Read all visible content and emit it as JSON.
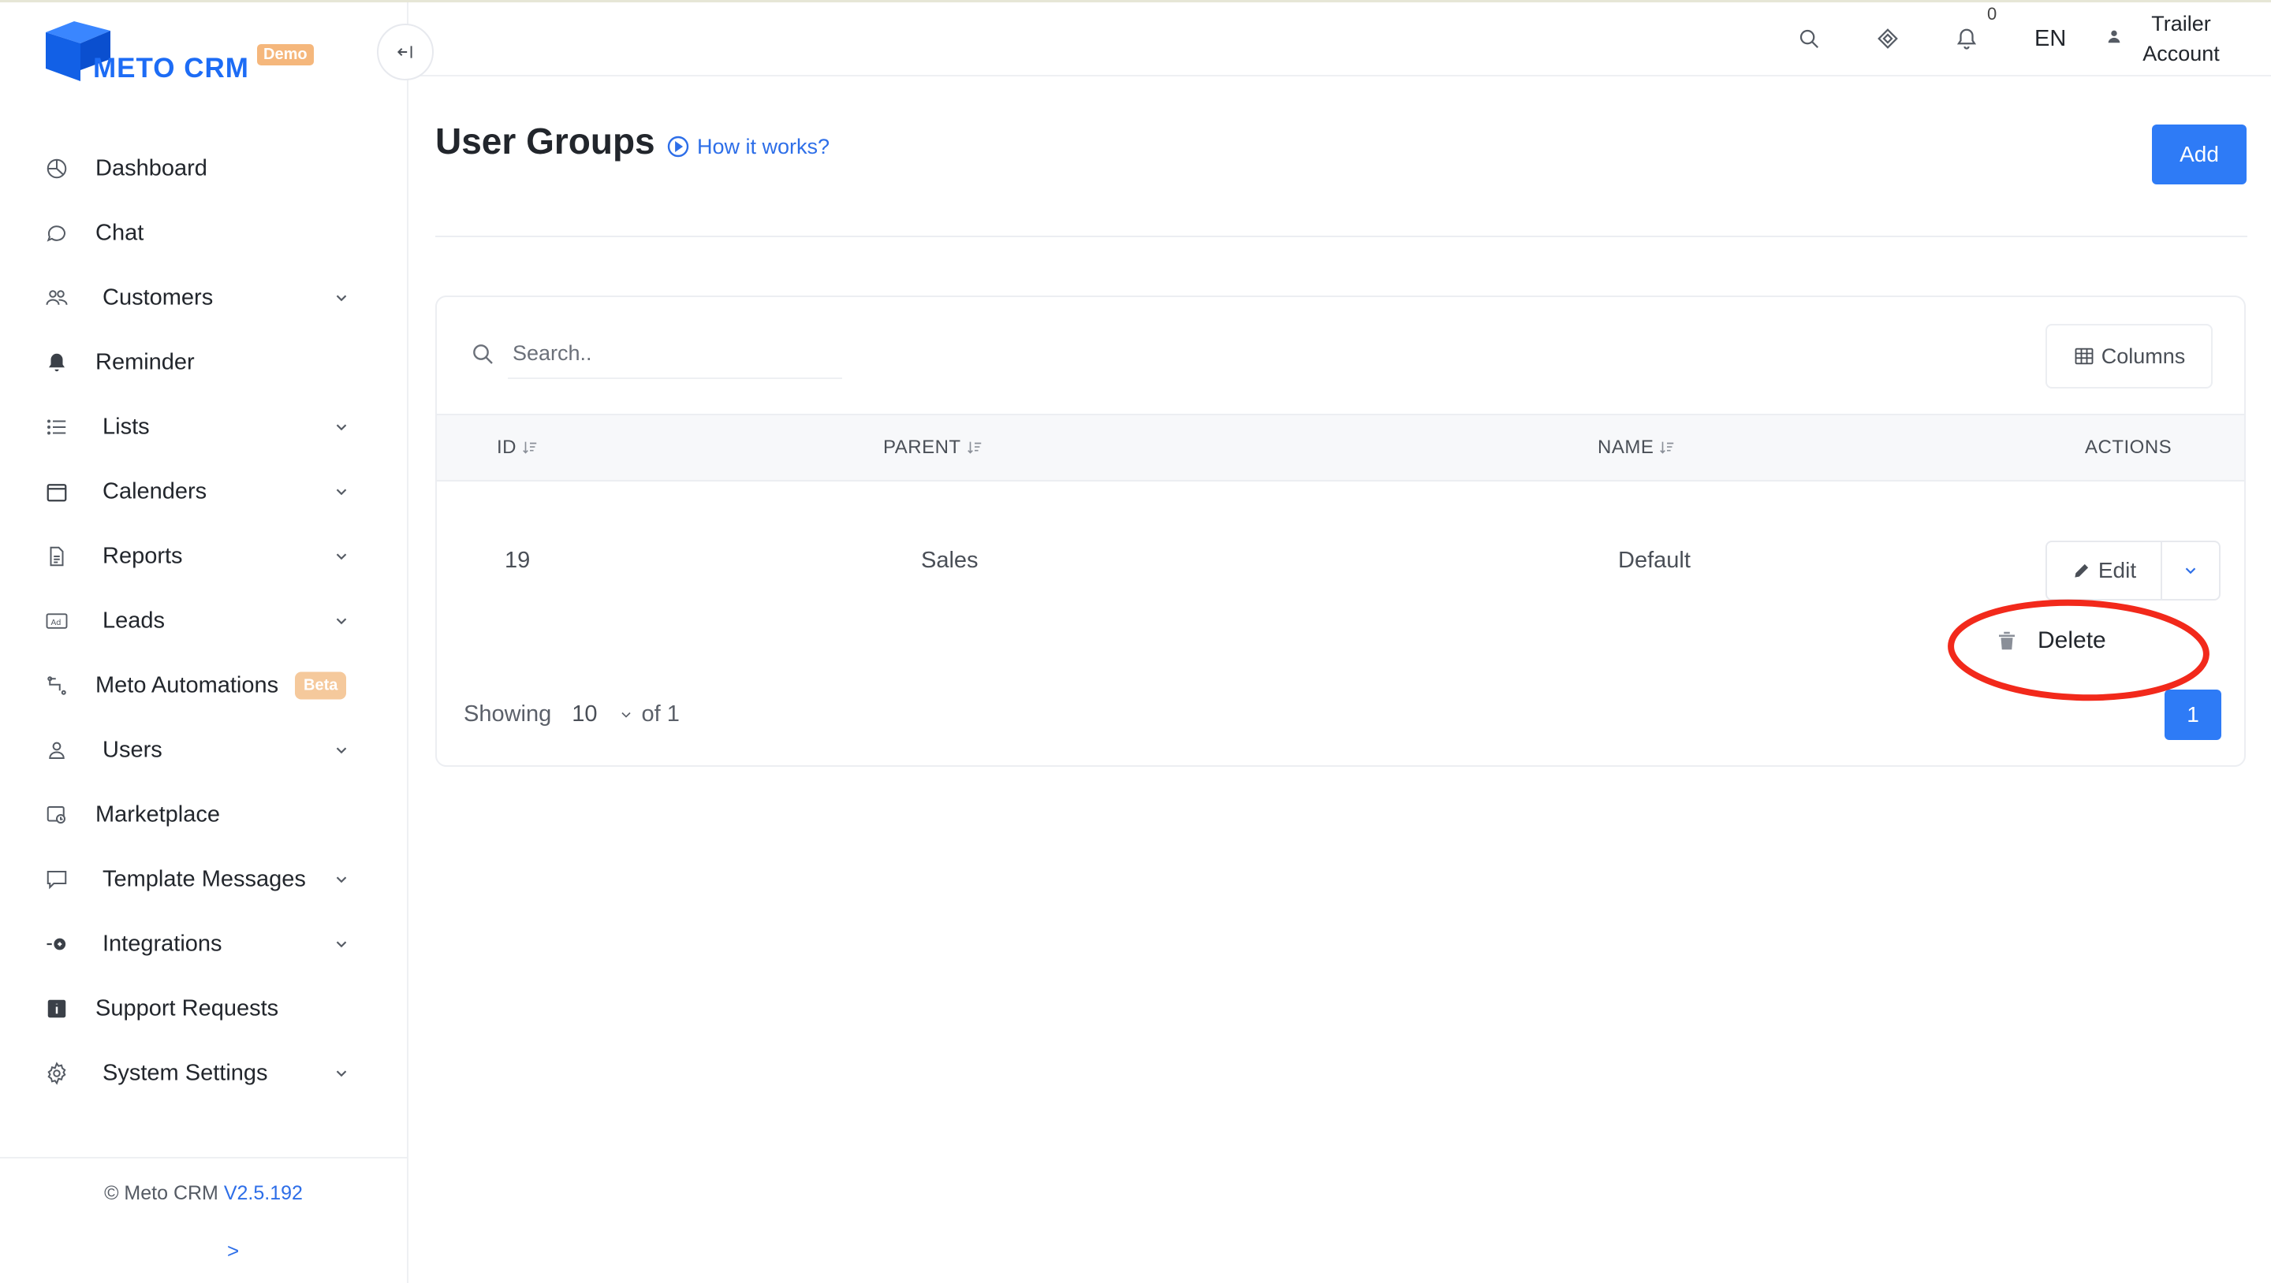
{
  "app": {
    "logo_text": "METO CRM",
    "logo_badge": "Demo",
    "brand_color": "#1d6cf5",
    "accent_color": "#2e7bf6",
    "badge_color": "#f5b77c"
  },
  "sidebar": {
    "items": [
      {
        "label": "Dashboard",
        "icon": "pie-chart-icon",
        "expandable": false
      },
      {
        "label": "Chat",
        "icon": "chat-bubble-icon",
        "expandable": false
      },
      {
        "label": "Customers",
        "icon": "users-icon",
        "expandable": true
      },
      {
        "label": "Reminder",
        "icon": "bell-icon",
        "expandable": false
      },
      {
        "label": "Lists",
        "icon": "list-icon",
        "expandable": true
      },
      {
        "label": "Calenders",
        "icon": "calendar-icon",
        "expandable": true
      },
      {
        "label": "Reports",
        "icon": "document-icon",
        "expandable": true
      },
      {
        "label": "Leads",
        "icon": "ad-icon",
        "expandable": true
      },
      {
        "label": "Meto Automations",
        "icon": "flow-icon",
        "expandable": false,
        "badge": "Beta"
      },
      {
        "label": "Users",
        "icon": "user-icon",
        "expandable": true
      },
      {
        "label": "Marketplace",
        "icon": "store-icon",
        "expandable": false
      },
      {
        "label": "Template Messages",
        "icon": "message-template-icon",
        "expandable": true
      },
      {
        "label": "Integrations",
        "icon": "integration-icon",
        "expandable": true
      },
      {
        "label": "Support Requests",
        "icon": "info-icon",
        "expandable": false
      },
      {
        "label": "System Settings",
        "icon": "gear-icon",
        "expandable": true
      }
    ],
    "footer": {
      "copyright": "© Meto CRM",
      "version": "V2.5.192",
      "expand": ">"
    }
  },
  "header": {
    "notification_count": "0",
    "language": "EN",
    "account_line1": "Trailer",
    "account_line2": "Account"
  },
  "main": {
    "title": "User Groups",
    "how_it_works": "How it works?",
    "add_label": "Add",
    "search_placeholder": "Search..",
    "columns_label": "Columns",
    "table": {
      "headers": [
        "ID",
        "PARENT",
        "NAME",
        "ACTIONS"
      ],
      "rows": [
        {
          "id": "19",
          "parent": "Sales",
          "name": "Default"
        }
      ],
      "edit_label": "Edit",
      "delete_label": "Delete"
    },
    "pagination": {
      "showing_label": "Showing",
      "page_size": "10",
      "of_label": "of 1",
      "current_page": "1"
    }
  }
}
